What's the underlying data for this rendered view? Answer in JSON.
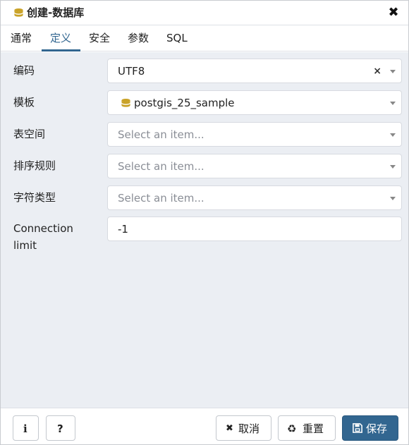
{
  "header": {
    "title": "创建-数据库",
    "close_glyph": "✖"
  },
  "tabs": [
    {
      "label": "通常"
    },
    {
      "label": "定义"
    },
    {
      "label": "安全"
    },
    {
      "label": "参数"
    },
    {
      "label": "SQL"
    }
  ],
  "form": {
    "encoding": {
      "label": "编码",
      "value": "UTF8",
      "clear_glyph": "×"
    },
    "template": {
      "label": "模板",
      "value": "postgis_25_sample"
    },
    "tablespace": {
      "label": "表空间",
      "placeholder": "Select an item..."
    },
    "collation": {
      "label": "排序规则",
      "placeholder": "Select an item..."
    },
    "ctype": {
      "label": "字符类型",
      "placeholder": "Select an item..."
    },
    "conn_limit": {
      "label_line1": "Connection",
      "label_line2": "limit",
      "value": "-1"
    }
  },
  "footer": {
    "info_glyph": "i",
    "help_glyph": "?",
    "cancel_glyph": "✖",
    "cancel_label": "取消",
    "reset_glyph": "♻",
    "reset_label": "重置",
    "save_label": "保存"
  },
  "colors": {
    "accent": "#326690",
    "db_icon": "#c9a227",
    "background": "#ebeef3"
  }
}
